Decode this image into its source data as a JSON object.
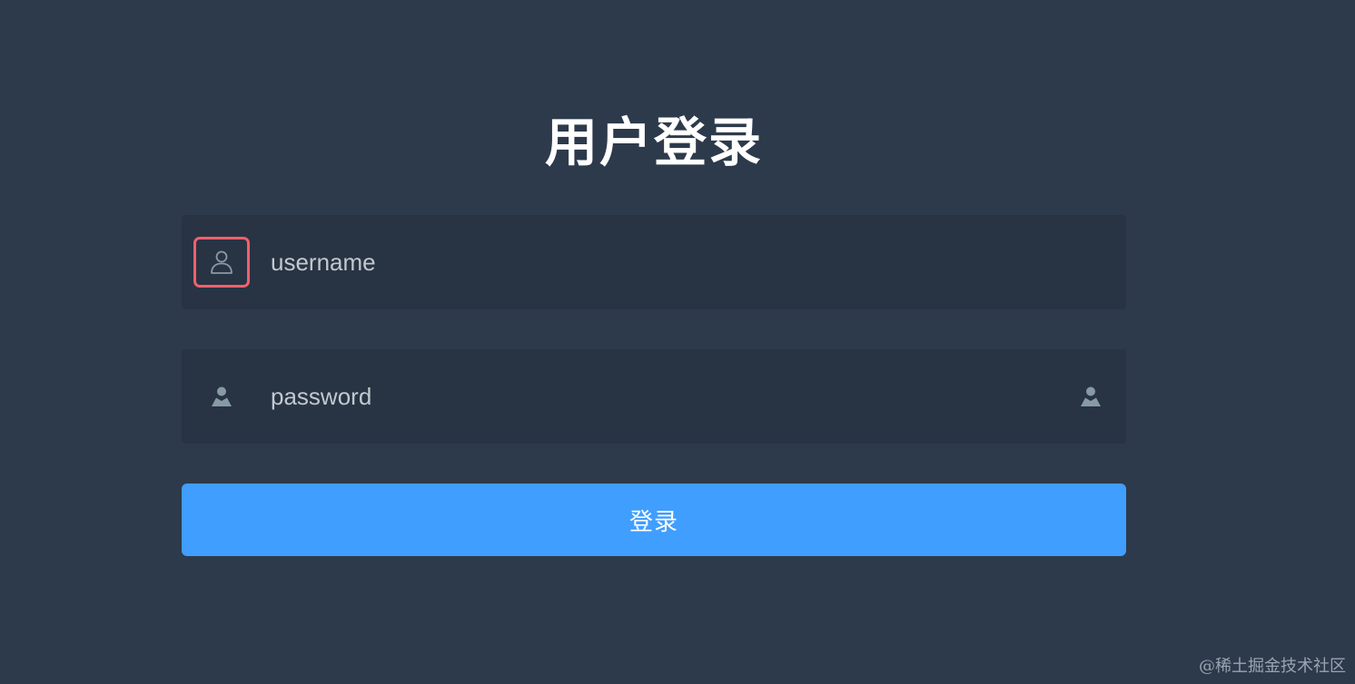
{
  "login": {
    "title": "用户登录",
    "username": {
      "placeholder": "username",
      "value": "",
      "icon": "user-outline-icon"
    },
    "password": {
      "placeholder": "password",
      "value": "",
      "icon": "user-solid-icon",
      "toggle_icon": "user-solid-icon"
    },
    "submit_label": "登录"
  },
  "watermark": "@稀土掘金技术社区",
  "colors": {
    "background": "#2d3a4b",
    "field_background": "#283443",
    "accent": "#409eff",
    "highlight": "#f0606c",
    "icon": "#889aa4"
  }
}
